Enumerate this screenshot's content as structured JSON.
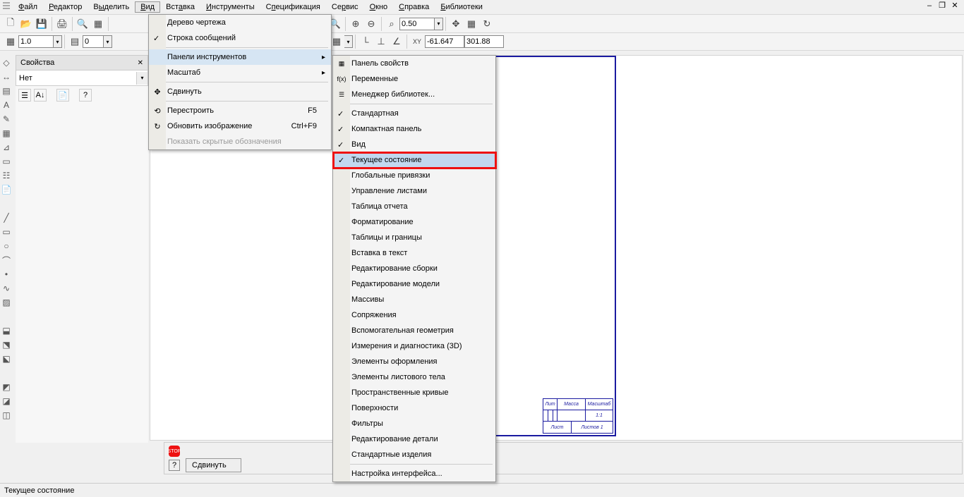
{
  "menubar": {
    "items": [
      {
        "label": "Файл",
        "u": "Ф"
      },
      {
        "label": "Редактор",
        "u": "Р"
      },
      {
        "label": "Выделить",
        "u": "ы"
      },
      {
        "label": "Вид",
        "u": "В",
        "active": true
      },
      {
        "label": "Вставка",
        "u": "а"
      },
      {
        "label": "Инструменты",
        "u": "И"
      },
      {
        "label": "Спецификация",
        "u": "п"
      },
      {
        "label": "Сервис",
        "u": "р"
      },
      {
        "label": "Окно",
        "u": "О"
      },
      {
        "label": "Справка",
        "u": "С"
      },
      {
        "label": "Библиотеки",
        "u": "Б"
      }
    ]
  },
  "toolbar1": {
    "zoom": "0.50"
  },
  "toolbar2": {
    "scale": "1.0",
    "step": "0",
    "coordX": "-61.647",
    "coordY": "301.88"
  },
  "props": {
    "title": "Свойства",
    "value": "Нет"
  },
  "viewMenu": {
    "items": [
      {
        "label": "Дерево чертежа"
      },
      {
        "label": "Строка сообщений",
        "check": true
      },
      {
        "sep": true
      },
      {
        "label": "Панели инструментов",
        "arrow": true,
        "active": true
      },
      {
        "label": "Масштаб",
        "arrow": true
      },
      {
        "sep": true
      },
      {
        "label": "Сдвинуть",
        "icon": "✥"
      },
      {
        "sep": true
      },
      {
        "label": "Перестроить",
        "shortcut": "F5",
        "icon": "⟲"
      },
      {
        "label": "Обновить изображение",
        "shortcut": "Ctrl+F9",
        "icon": "↻"
      },
      {
        "label": "Показать скрытые обозначения",
        "disabled": true
      }
    ]
  },
  "panelsMenu": {
    "items": [
      {
        "label": "Панель свойств",
        "icon": "▦"
      },
      {
        "label": "Переменные",
        "icon": "f(x)"
      },
      {
        "label": "Менеджер библиотек...",
        "icon": "☰"
      },
      {
        "sep": true
      },
      {
        "label": "Стандартная",
        "check": true
      },
      {
        "label": "Компактная панель",
        "check": true
      },
      {
        "label": "Вид",
        "check": true
      },
      {
        "label": "Текущее состояние",
        "check": true,
        "highlight": true
      },
      {
        "label": "Глобальные привязки"
      },
      {
        "label": "Управление листами"
      },
      {
        "label": "Таблица отчета"
      },
      {
        "label": "Форматирование"
      },
      {
        "label": "Таблицы и границы"
      },
      {
        "label": "Вставка в текст"
      },
      {
        "label": "Редактирование сборки"
      },
      {
        "label": "Редактирование модели"
      },
      {
        "label": "Массивы"
      },
      {
        "label": "Сопряжения"
      },
      {
        "label": "Вспомогательная геометрия"
      },
      {
        "label": "Измерения и диагностика (3D)"
      },
      {
        "label": "Элементы оформления"
      },
      {
        "label": "Элементы листового тела"
      },
      {
        "label": "Пространственные кривые"
      },
      {
        "label": "Поверхности"
      },
      {
        "label": "Фильтры"
      },
      {
        "label": "Редактирование детали"
      },
      {
        "label": "Стандартные изделия"
      },
      {
        "sep": true
      },
      {
        "label": "Настройка интерфейса..."
      }
    ]
  },
  "bottom": {
    "btn": "Сдвинуть"
  },
  "status": {
    "text": "Текущее состояние"
  },
  "titleblock": {
    "h1": [
      "Лит",
      "Масса",
      "Масштаб"
    ],
    "scale": "1:1",
    "f1": "Лист",
    "f2": "Листов 1"
  }
}
